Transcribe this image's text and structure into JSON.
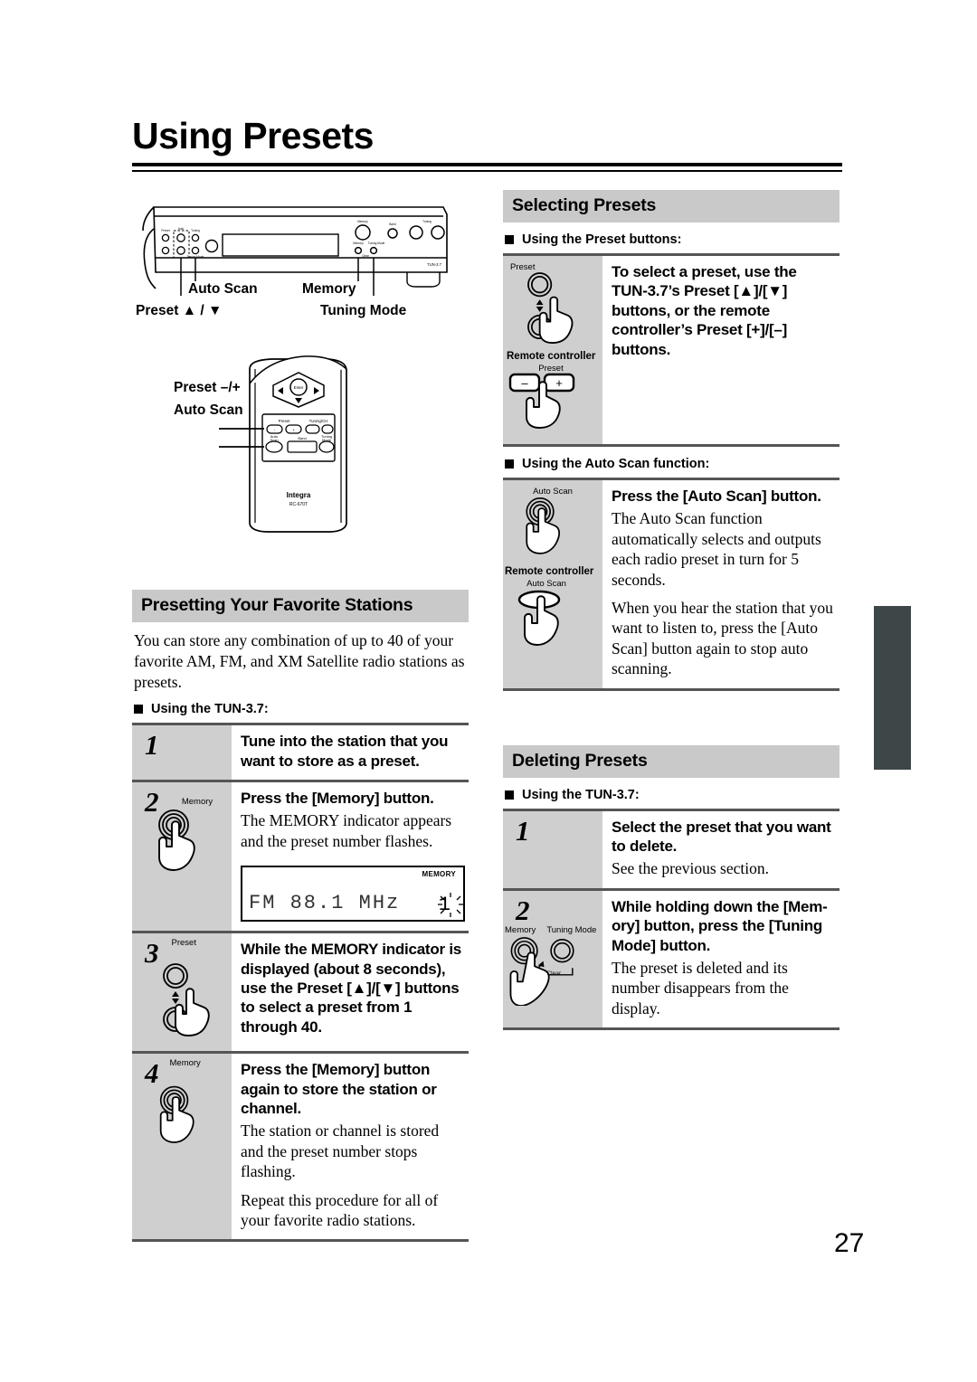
{
  "page": {
    "title": "Using Presets",
    "number": "27"
  },
  "figure_panel": {
    "callouts": [
      {
        "label": "Auto Scan"
      },
      {
        "label": "Preset ▲ / ▼"
      },
      {
        "label": "Memory"
      },
      {
        "label": "Tuning Mode"
      }
    ],
    "device_model": "TUN-3.7",
    "panel_buttons": [
      "Memory",
      "Band",
      "Tuning/CH"
    ],
    "panel_small_labels": [
      "Memory",
      "Tuning Mode",
      "Clear"
    ]
  },
  "figure_remote": {
    "callouts": [
      {
        "label": "Preset –/+"
      },
      {
        "label": "Auto Scan"
      }
    ],
    "brand": "Integra",
    "model": "RC-670T",
    "buttons": [
      "Enter",
      "Preset",
      "Tuning/CH",
      "Auto Scan",
      "Band",
      "Tuning Mode"
    ]
  },
  "sections": {
    "presetting": {
      "heading": "Presetting Your Favorite Stations",
      "intro": "You can store any combination of up to 40 of your favorite AM, FM, and XM Satellite radio stations as presets.",
      "subhead": "Using the TUN-3.7:",
      "steps": [
        {
          "number": "1",
          "bold": "Tune into the station that you want to store as a preset.",
          "paras": [],
          "icon": null
        },
        {
          "number": "2",
          "bold": "Press the [Memory] button.",
          "paras": [
            "The MEMORY indicator appears and the preset number flashes."
          ],
          "icon": "memory-button-press",
          "icon_label": "Memory",
          "display": {
            "band_freq": "FM  88.1 MHz",
            "memory_indicator": "MEMORY",
            "preset_number": "1"
          }
        },
        {
          "number": "3",
          "bold": "While the MEMORY indicator is displayed (about 8 seconds), use the Preset [▲]/[▼] buttons to select a preset from 1 through 40.",
          "paras": [],
          "icon": "preset-updown-press",
          "icon_label": "Preset"
        },
        {
          "number": "4",
          "bold": "Press the [Memory] button again to store the station or channel.",
          "paras": [
            "The station or channel is stored and the preset number stops flashing.",
            "Repeat this procedure for all of your favorite radio stations."
          ],
          "icon": "memory-button-press",
          "icon_label": "Memory"
        }
      ]
    },
    "selecting": {
      "heading": "Selecting Presets",
      "subhead_preset": "Using the Preset buttons:",
      "preset_step": {
        "bold": "To select a preset, use the TUN-3.7’s Preset [▲]/[▼] buttons, or the remote controller’s Preset [+]/[–] buttons.",
        "icon_label_unit": "Preset",
        "icon_label_remote": "Remote controller",
        "icon_label_remote_preset": "Preset",
        "remote_minus": "–",
        "remote_plus": "+"
      },
      "subhead_autoscan": "Using the Auto Scan function:",
      "autoscan_step": {
        "bold": "Press the [Auto Scan] button.",
        "paras": [
          "The Auto Scan function automatically selects and outputs each radio preset in turn for 5 seconds.",
          "When you hear the station that you want to listen to, press the [Auto Scan] button again to stop auto scanning."
        ],
        "icon_label_unit": "Auto Scan",
        "icon_label_remote": "Remote controller",
        "icon_label_remote_btn": "Auto Scan"
      }
    },
    "deleting": {
      "heading": "Deleting Presets",
      "subhead": "Using the TUN-3.7:",
      "steps": [
        {
          "number": "1",
          "bold": "Select the preset that you want to delete.",
          "paras": [
            "See the previous section."
          ],
          "icon": null
        },
        {
          "number": "2",
          "bold": "While holding down the [Mem-ory] button, press the [Tuning Mode] button.",
          "paras": [
            "The preset is deleted and its number disappears from the display."
          ],
          "icon": "memory-tuningmode-press",
          "icon_label_a": "Memory",
          "icon_label_b": "Tuning Mode",
          "icon_label_c": "Clear"
        }
      ]
    }
  },
  "colors": {
    "section_header_bg": "#c9c9c9",
    "step_number_bg": "#cfcfcf",
    "rule": "#555555",
    "edge_tab": "#3e4748"
  }
}
